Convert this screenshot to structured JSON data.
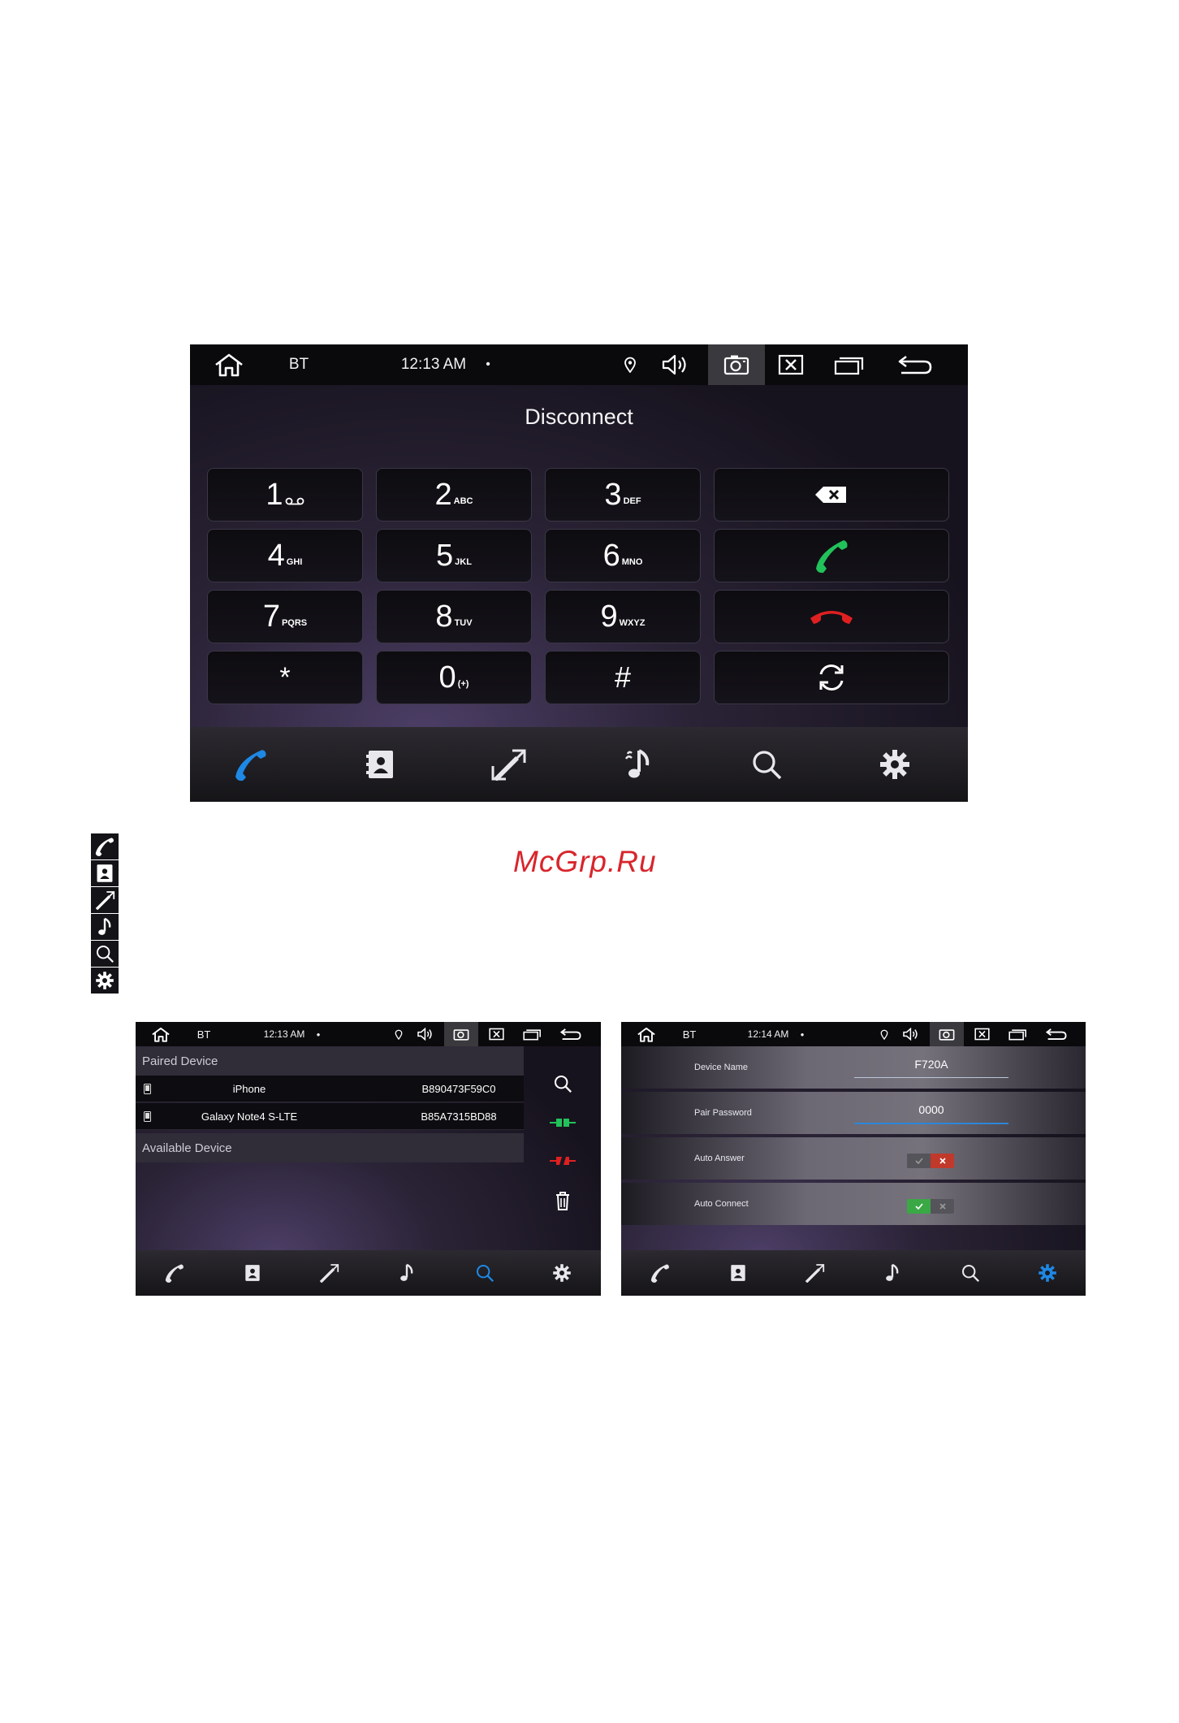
{
  "dialer": {
    "statusbar": {
      "app": "BT",
      "time": "12:13 AM",
      "dot": "•"
    },
    "title": "Disconnect",
    "keys": [
      {
        "digit": "1",
        "letters": "oo"
      },
      {
        "digit": "2",
        "letters": "ABC"
      },
      {
        "digit": "3",
        "letters": "DEF"
      },
      {
        "digit": "4",
        "letters": "GHI"
      },
      {
        "digit": "5",
        "letters": "JKL"
      },
      {
        "digit": "6",
        "letters": "MNO"
      },
      {
        "digit": "7",
        "letters": "PQRS"
      },
      {
        "digit": "8",
        "letters": "TUV"
      },
      {
        "digit": "9",
        "letters": "WXYZ"
      },
      {
        "digit": "*",
        "letters": ""
      },
      {
        "digit": "0",
        "letters": "(+)"
      },
      {
        "digit": "#",
        "letters": ""
      }
    ],
    "bottom_nav": [
      "phone-icon",
      "contacts-icon",
      "call-log-icon",
      "music-icon",
      "search-icon",
      "settings-icon"
    ],
    "active_color": "#1e88e5"
  },
  "legend_icons": [
    "phone-icon",
    "contacts-icon",
    "call-log-icon",
    "music-icon",
    "search-icon",
    "settings-icon"
  ],
  "watermark": "McGrp.Ru",
  "devices_screen": {
    "statusbar": {
      "app": "BT",
      "time": "12:13 AM",
      "dot": "•"
    },
    "paired_header": "Paired Device",
    "paired": [
      {
        "name": "iPhone",
        "address": "B890473F59C0"
      },
      {
        "name": "Galaxy Note4 S-LTE",
        "address": "B85A7315BD88"
      }
    ],
    "available_header": "Available Device",
    "side_actions": [
      "search-icon",
      "connect-icon",
      "disconnect-icon",
      "trash-icon"
    ],
    "active_tab": "search-icon"
  },
  "settings_screen": {
    "statusbar": {
      "app": "BT",
      "time": "12:14 AM",
      "dot": "•"
    },
    "device_name_label": "Device Name",
    "device_name_value": "F720A",
    "pair_password_label": "Pair Password",
    "pair_password_value": "0000",
    "auto_answer_label": "Auto Answer",
    "auto_answer_on": false,
    "auto_connect_label": "Auto Connect",
    "auto_connect_on": true,
    "active_tab": "settings-icon"
  },
  "colors": {
    "green": "#22c25a",
    "red": "#e02020",
    "blue": "#1e88e5"
  }
}
